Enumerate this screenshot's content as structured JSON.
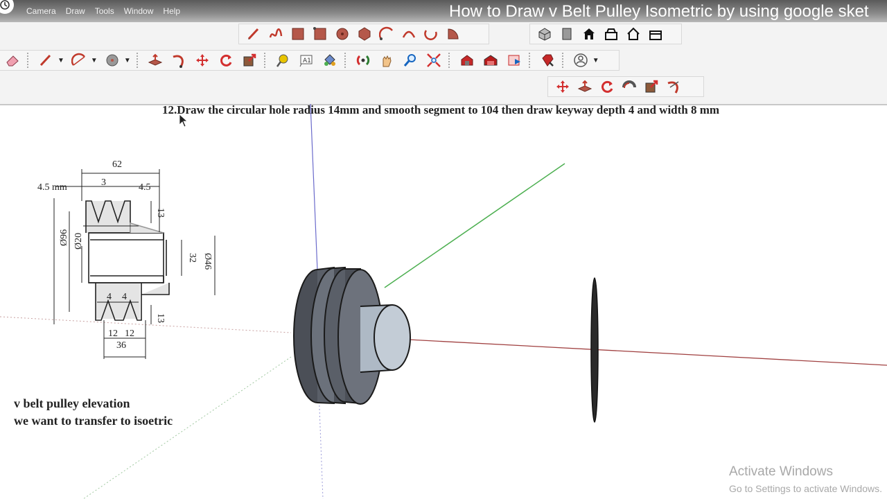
{
  "video": {
    "title": "How to Draw v Belt Pulley Isometric by using google sket"
  },
  "menu": [
    "Camera",
    "Draw",
    "Tools",
    "Window",
    "Help"
  ],
  "toolbars": {
    "draw": [
      "line-pencil-icon",
      "freehand-icon",
      "rectangle-icon",
      "rotated-rectangle-icon",
      "circle-icon",
      "polygon-icon",
      "arc-icon",
      "two-point-arc-icon",
      "three-point-arc-icon",
      "pie-icon"
    ],
    "views": [
      "iso-view-icon",
      "front-view-icon",
      "top-view-icon",
      "right-view-icon",
      "back-view-icon",
      "left-view-icon"
    ],
    "main": [
      "eraser-icon",
      "pencil-icon",
      "arc-tool-icon",
      "shape-icon",
      "push-pull-icon",
      "follow-me-icon",
      "move-icon",
      "rotate-icon",
      "scale-icon",
      "tape-measure-icon",
      "text-tool-icon",
      "paint-bucket-icon",
      "orbit-icon",
      "pan-icon",
      "zoom-icon",
      "zoom-extents-icon",
      "warehouse-icon",
      "extension-warehouse-icon",
      "layout-icon",
      "ruby-icon",
      "account-icon"
    ],
    "edit": [
      "move-icon",
      "push-pull-icon",
      "rotate-icon",
      "follow-me-icon",
      "scale-icon",
      "offset-icon"
    ]
  },
  "instruction": "12.Draw the circular hole radius 14mm and smooth segment to 104   then draw keyway depth 4 and width 8 mm",
  "elevation": {
    "dims": {
      "overall": "62",
      "left_edge": "4.5 mm",
      "groove": "3",
      "right_edge": "4.5",
      "top_depth": "13",
      "bottom_depth": "13",
      "bore": "32",
      "hub": "Ø46",
      "dia_outer": "Ø96",
      "dia_inner": "Ø20",
      "groove_bottom_a": "4",
      "groove_bottom_b": "4",
      "bottom_w1": "12",
      "bottom_w2": "12",
      "bottom_total": "36"
    }
  },
  "notes": {
    "line1": "v belt pulley elevation",
    "line2": "we want to transfer to isoetric"
  },
  "watermark": {
    "line1": "Activate Windows",
    "line2": "Go to Settings to activate Windows."
  }
}
